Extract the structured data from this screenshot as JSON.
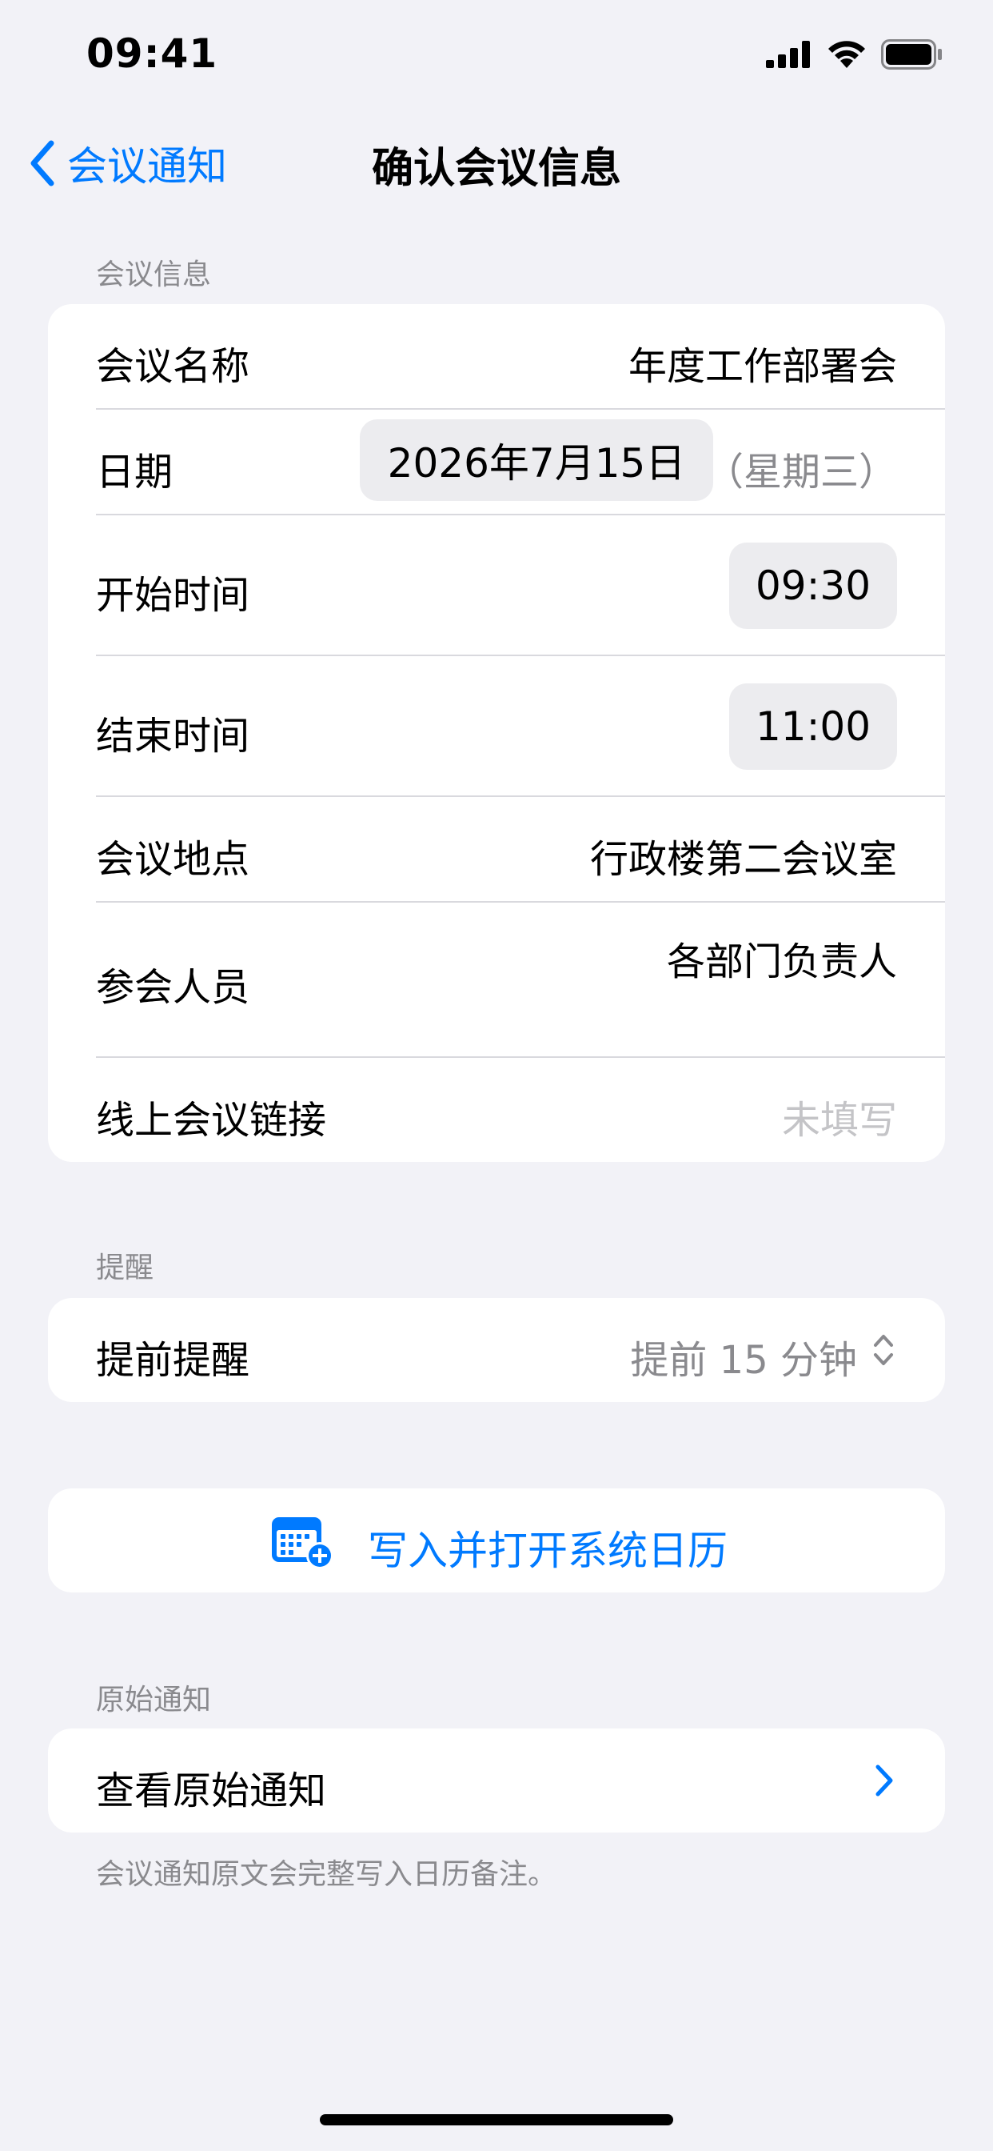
{
  "status_bar": {
    "time": "09:41"
  },
  "nav": {
    "back_label": "会议通知",
    "title": "确认会议信息"
  },
  "meeting_info": {
    "section_title": "会议信息",
    "name_label": "会议名称",
    "name_value": "年度工作部署会",
    "date_label": "日期",
    "date_value": "2026年7月15日",
    "weekday_value": "（星期三）",
    "start_label": "开始时间",
    "start_value": "09:30",
    "end_label": "结束时间",
    "end_value": "11:00",
    "location_label": "会议地点",
    "location_value": "行政楼第二会议室",
    "attendees_label": "参会人员",
    "attendees_value": "各部门负责人",
    "link_label": "线上会议链接",
    "link_placeholder": "未填写"
  },
  "reminder": {
    "section_title": "提醒",
    "label": "提前提醒",
    "value": "提前 15 分钟"
  },
  "calendar_action": {
    "label": "写入并打开系统日历"
  },
  "original": {
    "section_title": "原始通知",
    "view_label": "查看原始通知",
    "note": "会议通知原文会完整写入日历备注。"
  },
  "colors": {
    "accent": "#007aff",
    "background": "#f2f2f7",
    "secondary_text": "#8a8a8e"
  }
}
